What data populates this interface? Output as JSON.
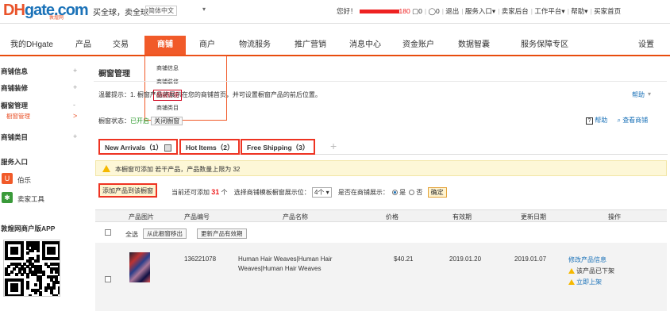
{
  "logo": {
    "dh": "DH",
    "gate": "gate.com",
    "sub": "敦煌网"
  },
  "topbar": {
    "slogan": "买全球，卖全球",
    "language": "简体中文",
    "greeting": "您好！",
    "count": "180",
    "msgs": "0",
    "cart": "0",
    "links": [
      "退出",
      "服务入口",
      "卖家后台",
      "工作平台",
      "帮助",
      "买家首页"
    ]
  },
  "nav": {
    "items": [
      "我的DHgate",
      "产品",
      "交易",
      "商铺",
      "商户",
      "物流服务",
      "推广营销",
      "消息中心",
      "资金账户",
      "数据智囊",
      "服务保障专区"
    ],
    "right": "设置",
    "active_index": 3
  },
  "dropdown": {
    "items": [
      "商铺信息",
      "商铺装修",
      "橱窗管理",
      "商铺类目"
    ],
    "selected_index": 2
  },
  "sidebar": {
    "items": [
      {
        "label": "商铺信息",
        "exp": "+"
      },
      {
        "label": "商铺装修",
        "exp": "+"
      },
      {
        "label": "橱窗管理",
        "exp": "-"
      },
      {
        "label": "橱窗管理",
        "exp": ">",
        "sub": true
      },
      {
        "label": "商铺类目",
        "exp": "+"
      }
    ],
    "service_title": "服务入口",
    "services": [
      "伯乐",
      "卖家工具"
    ],
    "app_title": "敦煌网商户版APP"
  },
  "page": {
    "title": "橱窗管理",
    "tip": "温馨提示：1. 橱窗产品将展示在您的商铺首页，并可设置橱窗产品的前后位置。",
    "help": "帮助",
    "status_prefix": "橱窗状态：",
    "status_value": "已开启",
    "status_btn": "关闭橱窗",
    "right_links": [
      "帮助",
      "查看商铺"
    ]
  },
  "tabs": [
    {
      "label": "New Arrivals（1）"
    },
    {
      "label": "Hot Items（2）"
    },
    {
      "label": "Free Shipping（3）"
    }
  ],
  "warning": "本橱窗可添加 若干产品，产品数量上限为 32",
  "actions": {
    "add_btn": "添加产品到该橱窗",
    "can_add_prefix": "当前还可添加",
    "can_add_num": "31",
    "can_add_suffix": "个",
    "select_label": "选择商铺模板橱窗展示位：",
    "select_value": "4个",
    "show_label": "是否在商铺展示：",
    "opt_yes": "是",
    "opt_no": "否",
    "ok_btn": "确定"
  },
  "table": {
    "headers": [
      "产品图片",
      "产品编号",
      "产品名称",
      "价格",
      "有效期",
      "更新日期",
      "操作"
    ],
    "select_all": "全选",
    "remove_btn": "从此橱窗移出",
    "refresh_btn": "更新产品有效期",
    "rows": [
      {
        "id": "136221078",
        "name1": "Human Hair Weaves|Human Hair",
        "name2": "Weaves|Human Hair Weaves",
        "price": "$40.21",
        "valid": "2019.01.20",
        "updated": "2019.01.07",
        "op1": "修改产品信息",
        "op2": "该产品已下架",
        "op3": "立即上架"
      }
    ]
  }
}
